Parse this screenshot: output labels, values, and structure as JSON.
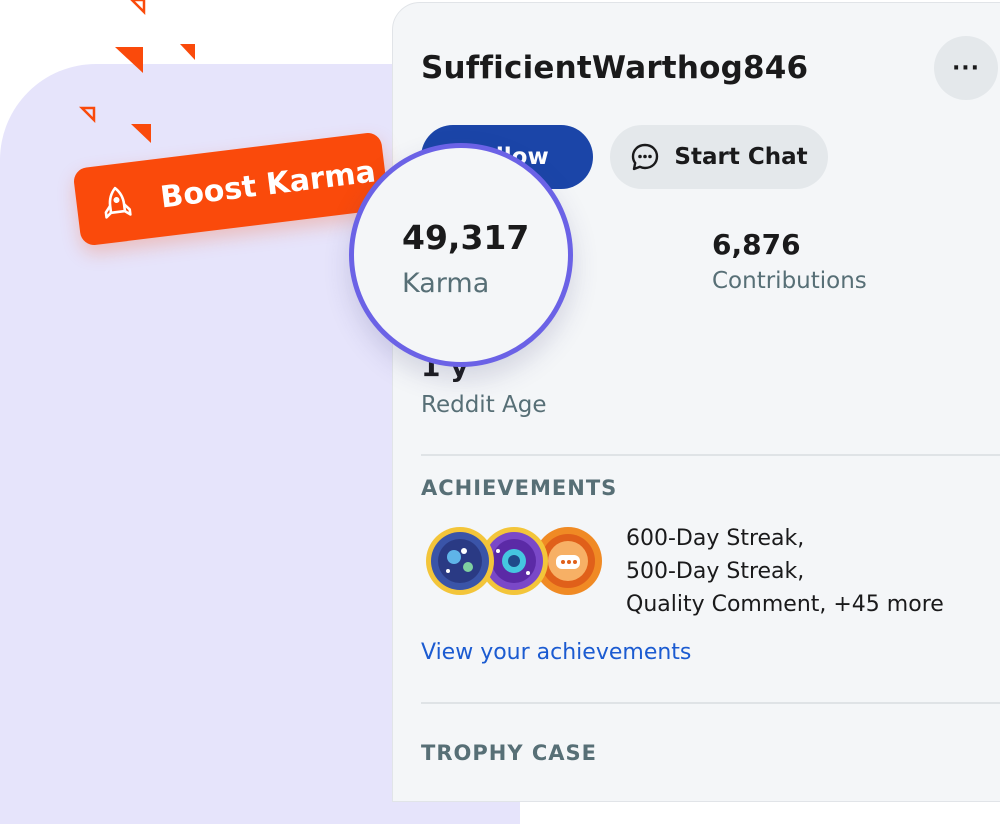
{
  "profile": {
    "username": "SufficientWarthog846",
    "more_label": "···"
  },
  "actions": {
    "follow_label": "Follow",
    "chat_label": "Start Chat"
  },
  "stats": {
    "karma": {
      "value": "49,317",
      "label": "Karma"
    },
    "contributions": {
      "value": "6,876",
      "label": "Contributions"
    },
    "reddit_age": {
      "value": "1 y",
      "label": "Reddit Age"
    }
  },
  "boost": {
    "label": "Boost Karma",
    "color": "#fa4a0b"
  },
  "achievements": {
    "title": "ACHIEVEMENTS",
    "lines": [
      "600-Day Streak,",
      "500-Day Streak,",
      "Quality Comment, +45 more"
    ],
    "link": "View your achievements"
  },
  "trophy_case": {
    "title": "TROPHY CASE"
  },
  "colors": {
    "accent": "#6b62e6",
    "follow_button": "#1b45a8",
    "link": "#1b5bd1",
    "background_blob": "#e6e4fb"
  },
  "icons": {
    "more": "ellipsis-icon",
    "chat": "chat-bubble-icon",
    "boost": "rocket-icon"
  }
}
